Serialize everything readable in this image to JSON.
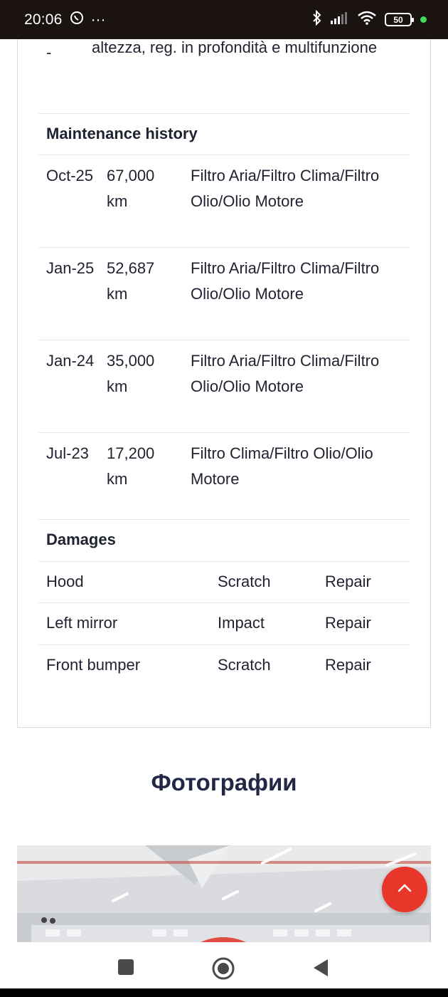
{
  "status_bar": {
    "time": "20:06",
    "dots": "···",
    "battery": "50",
    "dot_color": "#3ddc5a"
  },
  "features": {
    "dash": "-",
    "text": "altezza, reg. in profondità e multifunzione"
  },
  "maintenance": {
    "title": "Maintenance history",
    "rows": [
      {
        "date": "Oct-25",
        "km": "67,000 km",
        "work": "Filtro Aria/Filtro Clima/Filtro Olio/Olio Motore"
      },
      {
        "date": "Jan-25",
        "km": "52,687 km",
        "work": "Filtro Aria/Filtro Clima/Filtro Olio/Olio Motore"
      },
      {
        "date": "Jan-24",
        "km": "35,000 km",
        "work": "Filtro Aria/Filtro Clima/Filtro Olio/Olio Motore"
      },
      {
        "date": "Jul-23",
        "km": "17,200 km",
        "work": "Filtro Clima/Filtro Olio/Olio Motore"
      }
    ]
  },
  "damages": {
    "title": "Damages",
    "rows": [
      {
        "part": "Hood",
        "type": "Scratch",
        "action": "Repair"
      },
      {
        "part": "Left mirror",
        "type": "Impact",
        "action": "Repair"
      },
      {
        "part": "Front bumper",
        "type": "Scratch",
        "action": "Repair"
      }
    ]
  },
  "photos": {
    "title": "Фотографии"
  },
  "colors": {
    "accent": "#e8362a",
    "heading": "#232746"
  },
  "icons": {
    "fab": "chevron-up-icon",
    "nav_recent": "square-icon",
    "nav_home": "circle-icon",
    "nav_back": "triangle-back-icon"
  }
}
